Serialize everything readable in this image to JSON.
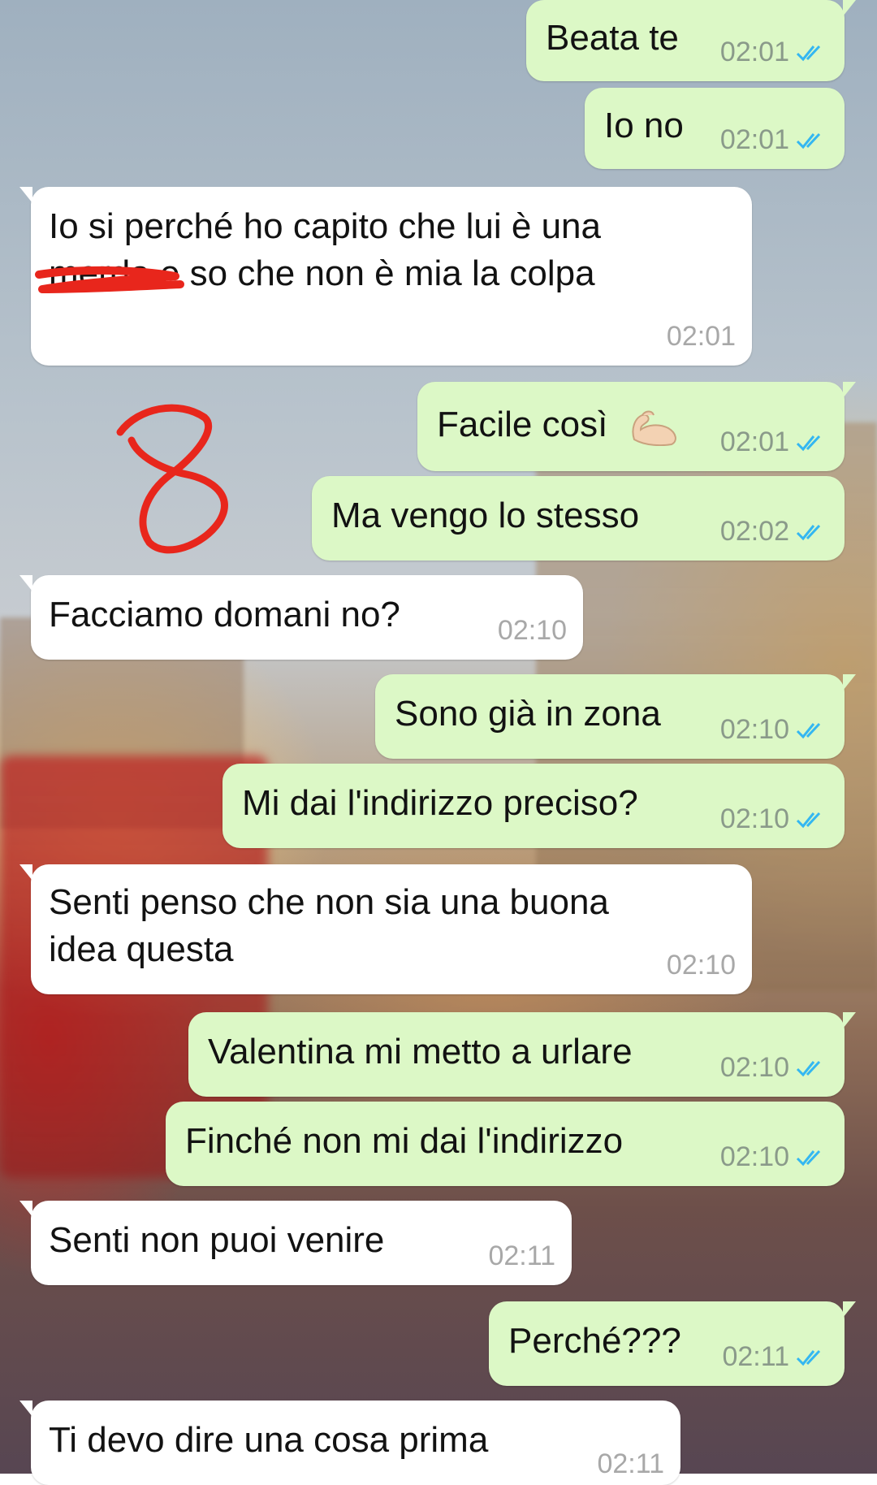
{
  "messages": [
    {
      "dir": "out",
      "text": "Beata te",
      "time": "02:01"
    },
    {
      "dir": "out",
      "text": "Io no",
      "time": "02:01"
    },
    {
      "dir": "in",
      "text_line1": "Io si perché ho capito che lui è una",
      "text_line2": "merda e so che non è mia la colpa",
      "time": "02:01"
    },
    {
      "dir": "out",
      "text": "Facile così",
      "emoji": "flexed-biceps",
      "time": "02:01"
    },
    {
      "dir": "out",
      "text": "Ma vengo lo stesso",
      "time": "02:02"
    },
    {
      "dir": "in",
      "text": "Facciamo domani no?",
      "time": "02:10"
    },
    {
      "dir": "out",
      "text": "Sono già in zona",
      "time": "02:10"
    },
    {
      "dir": "out",
      "text": "Mi dai l'indirizzo preciso?",
      "time": "02:10"
    },
    {
      "dir": "in",
      "text_line1": "Senti penso che non sia una buona",
      "text_line2": "idea questa",
      "time": "02:10"
    },
    {
      "dir": "out",
      "text": "Valentina mi metto a urlare",
      "time": "02:10"
    },
    {
      "dir": "out",
      "text": "Finché non mi dai l'indirizzo",
      "time": "02:10"
    },
    {
      "dir": "in",
      "text": "Senti non puoi venire",
      "time": "02:11"
    },
    {
      "dir": "out",
      "text": "Perché???",
      "time": "02:11"
    },
    {
      "dir": "in",
      "text": "Ti devo dire una cosa prima",
      "time": "02:11"
    }
  ],
  "annotation": {
    "drawn_mark": "8"
  },
  "colors": {
    "outgoing_bubble": "#dcf8c6",
    "incoming_bubble": "#ffffff",
    "read_ticks": "#34b7f1",
    "annotation_red": "#e8261c"
  },
  "icons": {
    "read_receipt": "double-check-icon"
  }
}
